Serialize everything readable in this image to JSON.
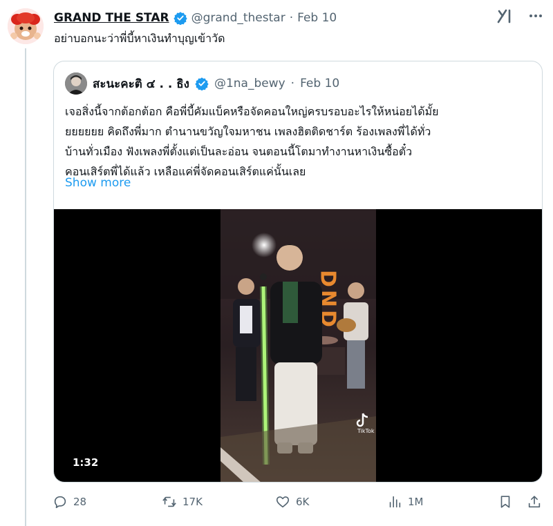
{
  "tweet": {
    "author_name": "GRAND THE STAR",
    "handle": "@grand_thestar",
    "separator": "·",
    "date": "Feb 10",
    "text": "อย่าบอกนะว่าพี่บี้หาเงินทำบุญเข้าวัด"
  },
  "quote": {
    "author_name": "สะนะคะติ ๔ . . ธิง",
    "handle": "@1na_bewy",
    "separator": "·",
    "date": "Feb 10",
    "lines": [
      "เจอสิ่งนี้จากต้อกต้อก คือพี่บี้คัมแบ็คหรือจัดคอนใหญ่ครบรอบอะไรให้หน่อยได้มั้ย",
      "ยยยยยย คิดถึงพี่มาก ตำนานขวัญใจมหาชน เพลงฮิตติดชาร์ต ร้องเพลงพี่ได้ทั่ว",
      "บ้านทั่วเมือง ฟังเพลงพี่ตั้งแต่เป็นละอ่อน จนตอนนี้โตมาทำงานหาเงินซื้อตั๋ว",
      "คอนเสิร์ตพี่ได้แล้ว เหลือแค่พี่จัดคอนเสิร์ตแค่นั้นเลย"
    ],
    "show_more": "Show more",
    "video": {
      "duration": "1:32",
      "stage_sign": "DND",
      "watermark": "TikTok"
    }
  },
  "actions": {
    "replies": "28",
    "reposts": "17K",
    "likes": "6K",
    "views": "1M"
  },
  "colors": {
    "accent": "#1d9bf0",
    "muted": "#536471",
    "border": "#cfd9de"
  },
  "icons": [
    "grok-icon",
    "more-icon",
    "verified-badge-icon",
    "reply-icon",
    "repost-icon",
    "like-icon",
    "views-icon",
    "bookmark-icon",
    "share-icon",
    "tiktok-icon"
  ]
}
